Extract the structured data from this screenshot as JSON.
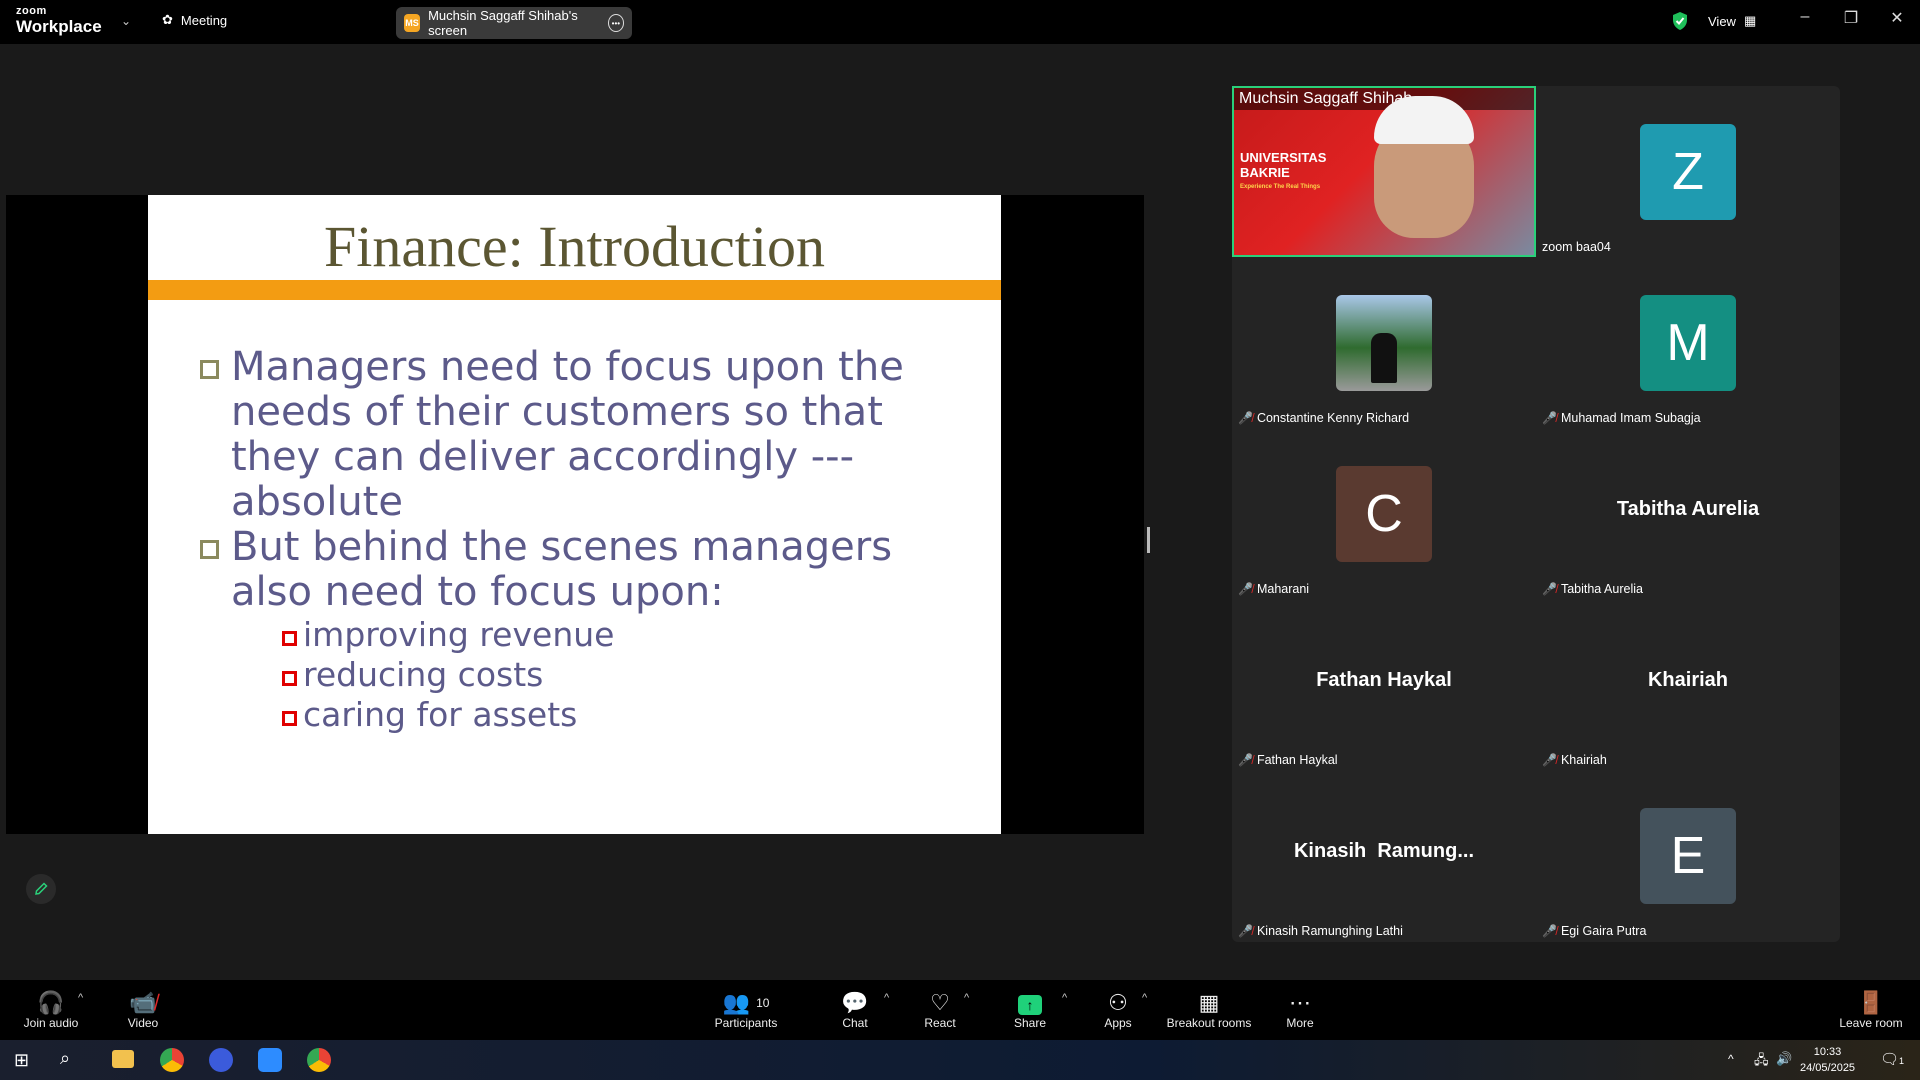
{
  "app": {
    "logo_small": "zoom",
    "logo_big": "Workplace",
    "meeting_label": "Meeting",
    "screen_badge": "MS",
    "screen_label": "Muchsin Saggaff Shihab's screen",
    "view_label": "View"
  },
  "slide": {
    "title": "Finance: Introduction",
    "bullets": [
      "Managers need to focus upon the needs of their customers so that they can deliver accordingly --- absolute",
      "But behind the scenes managers also need to focus upon:"
    ],
    "sub_bullets": [
      "improving revenue",
      "reducing costs",
      "caring for assets"
    ]
  },
  "video": {
    "banner_line1": "UNIVERSITAS",
    "banner_line2": "BAKRIE",
    "banner_line3": "Experience The Real Things"
  },
  "participants": [
    {
      "name": "Muchsin Saggaff Shihab",
      "type": "video",
      "muted": false
    },
    {
      "name": "zoom baa04",
      "type": "avatar",
      "initial": "Z",
      "color": "#1f9bb0",
      "muted": false
    },
    {
      "name": "Constantine Kenny Richard",
      "type": "photo",
      "muted": true
    },
    {
      "name": "Muhamad Imam Subagja",
      "type": "avatar",
      "initial": "M",
      "color": "#148f82",
      "muted": true
    },
    {
      "name": "Maharani",
      "type": "avatar",
      "initial": "C",
      "color": "#5a3a30",
      "muted": true
    },
    {
      "name": "Tabitha Aurelia",
      "type": "text",
      "display": "Tabitha Aurelia",
      "muted": true
    },
    {
      "name": "Fathan Haykal",
      "type": "text",
      "display": "Fathan Haykal",
      "muted": true
    },
    {
      "name": "Khairiah",
      "type": "text",
      "display": "Khairiah",
      "muted": true
    },
    {
      "name": "Kinasih Ramunghing Lathi",
      "type": "text",
      "display": "Kinasih  Ramung...",
      "muted": true
    },
    {
      "name": "Egi Gaira Putra",
      "type": "avatar",
      "initial": "E",
      "color": "#44525c",
      "muted": true
    }
  ],
  "toolbar": {
    "join_audio": "Join audio",
    "video": "Video",
    "participants": "Participants",
    "participants_count": "10",
    "chat": "Chat",
    "react": "React",
    "share": "Share",
    "apps": "Apps",
    "breakout": "Breakout rooms",
    "more": "More",
    "leave": "Leave room"
  },
  "taskbar": {
    "time": "10:33",
    "date": "24/05/2025",
    "notif_count": "1"
  },
  "colors": {
    "slide_accent": "#f39c12",
    "active_speaker_border": "#2ad07a",
    "share_green": "#1fd17a",
    "mute_red": "#e02828"
  }
}
